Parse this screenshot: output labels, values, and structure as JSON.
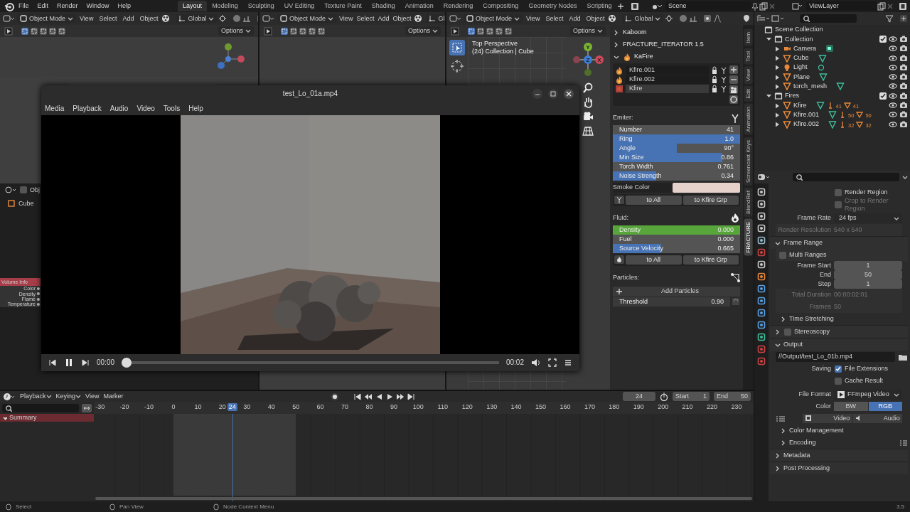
{
  "top_bar": {
    "menus": [
      "File",
      "Edit",
      "Render",
      "Window",
      "Help"
    ],
    "workspaces": [
      {
        "label": "Layout",
        "selected": true
      },
      {
        "label": "Modeling",
        "selected": false
      },
      {
        "label": "Sculpting",
        "selected": false
      },
      {
        "label": "UV Editing",
        "selected": false
      },
      {
        "label": "Texture Paint",
        "selected": false
      },
      {
        "label": "Shading",
        "selected": false
      },
      {
        "label": "Animation",
        "selected": false
      },
      {
        "label": "Rendering",
        "selected": false
      },
      {
        "label": "Compositing",
        "selected": false
      },
      {
        "label": "Geometry Nodes",
        "selected": false
      },
      {
        "label": "Scripting",
        "selected": false
      }
    ],
    "scene": "Scene",
    "view_layer": "ViewLayer"
  },
  "viewports": [
    {
      "mode": "Object Mode",
      "menus": [
        "View",
        "Select",
        "Add",
        "Object"
      ],
      "orientation": "Global",
      "options": "Options"
    },
    {
      "mode": "Object Mode",
      "menus": [
        "View",
        "Select",
        "Add",
        "Object"
      ],
      "orientation": "Gl",
      "options": "Options"
    },
    {
      "mode": "Object Mode",
      "menus": [
        "View",
        "Select",
        "Add",
        "Object"
      ],
      "orientation": "Global",
      "options": "Options",
      "view_name": "Top Perspective",
      "view_info": "(24) Collection | Cube",
      "axes": [
        "X",
        "Y",
        "Z"
      ]
    }
  ],
  "node_editor": {
    "header": "Obj",
    "object": "Cube",
    "node": {
      "title": "Volume Info",
      "sockets": [
        "Color",
        "Density",
        "Flame",
        "Temperature"
      ]
    }
  },
  "sidebar": {
    "sections": [
      {
        "title": "Kaboom",
        "expanded": false
      },
      {
        "title": "FRACTURE_ITERATOR 1.5",
        "expanded": false
      },
      {
        "title": "KaFire",
        "expanded": true
      }
    ],
    "fires": [
      {
        "name": "Kfire.001",
        "selected": false
      },
      {
        "name": "Kfire.002",
        "selected": false
      },
      {
        "name": "Kfire",
        "selected": true
      }
    ],
    "emitter_label": "Emiter:",
    "emitter": [
      {
        "label": "Number",
        "value": "41",
        "kind": "number"
      },
      {
        "label": "Ring",
        "value": "1.0",
        "kind": "slider",
        "level": 1
      },
      {
        "label": "Angle",
        "value": "90°",
        "kind": "slider",
        "level": 0.5
      },
      {
        "label": "Min Size",
        "value": "0.86",
        "kind": "slider",
        "level": 0.86
      },
      {
        "label": "Torch Width",
        "value": "0.761",
        "kind": "number"
      },
      {
        "label": "Noise Strength",
        "value": "0.34",
        "kind": "slider",
        "level": 0.34
      }
    ],
    "smoke_color": {
      "label": "Smoke Color",
      "color": "#e6d2ca"
    },
    "emitter_buttons": [
      "to All",
      "to Kfire Grp"
    ],
    "fluid_label": "Fluid:",
    "fluid": [
      {
        "label": "Density",
        "value": "0.000",
        "kind": "keyed"
      },
      {
        "label": "Fuel",
        "value": "0.000",
        "kind": "number"
      },
      {
        "label": "Source Velocity",
        "value": "0.665",
        "kind": "slider",
        "level": 0.38
      }
    ],
    "fluid_buttons": [
      "to All",
      "to Kfire Grp"
    ],
    "particles_label": "Particles:",
    "add_particles": "Add Particles",
    "threshold": {
      "label": "Threshold",
      "value": "0.90"
    },
    "tabs": [
      {
        "label": "Item",
        "selected": false
      },
      {
        "label": "Tool",
        "selected": false
      },
      {
        "label": "View",
        "selected": false
      },
      {
        "label": "Edit",
        "selected": false
      },
      {
        "label": "Animation",
        "selected": false
      },
      {
        "label": "Screencast Keys",
        "selected": false
      },
      {
        "label": "BlendRef",
        "selected": false
      },
      {
        "label": "FRACTURE",
        "selected": true
      }
    ]
  },
  "video_player": {
    "title": "test_Lo_01a.mp4",
    "menus": [
      "Media",
      "Playback",
      "Audio",
      "Video",
      "Tools",
      "Help"
    ],
    "playing": true,
    "elapsed": "00:00",
    "duration": "00:02",
    "level": 0
  },
  "outliner": {
    "title": "Scene Collection",
    "tree": [
      {
        "name": "Collection",
        "kind": "collection",
        "expanded": true,
        "checked": true,
        "children": [
          {
            "name": "Camera",
            "kind": "camera",
            "expanded": false
          },
          {
            "name": "Cube",
            "kind": "mesh",
            "expanded": false
          },
          {
            "name": "Light",
            "kind": "light",
            "expanded": false
          },
          {
            "name": "Plane",
            "kind": "mesh",
            "expanded": false
          },
          {
            "name": "torch_mesh",
            "kind": "mesh",
            "expanded": false
          }
        ]
      },
      {
        "name": "Fires",
        "kind": "collection",
        "expanded": true,
        "checked": true,
        "children": [
          {
            "name": "Kfire",
            "kind": "mesh",
            "expanded": false,
            "modifiers": [
              "41",
              "41"
            ]
          },
          {
            "name": "Kfire.001",
            "kind": "mesh",
            "expanded": false,
            "modifiers": [
              "50",
              "50"
            ]
          },
          {
            "name": "Kfire.002",
            "kind": "mesh",
            "expanded": false,
            "modifiers": [
              "32",
              "32"
            ]
          }
        ]
      }
    ]
  },
  "properties": {
    "rows": [
      {
        "kind": "check",
        "label": "Render Region",
        "checked": false
      },
      {
        "kind": "check",
        "label": "Crop to Render Region",
        "checked": false,
        "disabled": true
      },
      {
        "kind": "dropdown",
        "label": "Frame Rate",
        "value": "24 fps"
      },
      {
        "kind": "info",
        "label": "Render Resolution",
        "value": "540 x 540"
      },
      {
        "kind": "panel",
        "label": "Frame Range",
        "expanded": true
      },
      {
        "kind": "boxcheck",
        "label": "Multi Ranges",
        "checked": false
      },
      {
        "kind": "field",
        "label": "Frame Start",
        "value": "1"
      },
      {
        "kind": "field",
        "label": "End",
        "value": "50"
      },
      {
        "kind": "field",
        "label": "Step",
        "value": "1"
      },
      {
        "kind": "info",
        "label": "Total Duration",
        "value": "00:00:02:01"
      },
      {
        "kind": "info",
        "label": "Frames",
        "value": "50"
      },
      {
        "kind": "subpanel",
        "label": "Time Stretching",
        "expanded": false
      },
      {
        "kind": "panel",
        "label": "Stereoscopy",
        "expanded": false,
        "checked": false
      },
      {
        "kind": "panel",
        "label": "Output",
        "expanded": true
      },
      {
        "kind": "path",
        "value": "//Output/test_Lo_01b.mp4"
      },
      {
        "kind": "check",
        "prefix": "Saving",
        "label": "File Extensions",
        "checked": true
      },
      {
        "kind": "check",
        "label": "Cache Result",
        "checked": false
      },
      {
        "kind": "dropdown",
        "label": "File Format",
        "value": "FFmpeg Video"
      },
      {
        "kind": "toggle",
        "label": "Color",
        "options": [
          {
            "label": "BW",
            "selected": false
          },
          {
            "label": "RGB",
            "selected": true
          }
        ]
      },
      {
        "kind": "tabs",
        "options": [
          {
            "label": "Video"
          },
          {
            "label": "Audio"
          }
        ]
      },
      {
        "kind": "subpanel",
        "label": "Color Management",
        "expanded": false
      },
      {
        "kind": "subpanel",
        "label": "Encoding",
        "expanded": false
      },
      {
        "kind": "panel",
        "label": "Metadata",
        "expanded": false
      },
      {
        "kind": "panel",
        "label": "Post Processing",
        "expanded": false
      }
    ]
  },
  "timeline": {
    "menus": [
      "Playback",
      "Keying",
      "View",
      "Marker"
    ],
    "current_frame": "24",
    "playhead": "24",
    "start_label": "Start",
    "start": "1",
    "end_label": "End",
    "end": "50",
    "ruler": [
      "-30",
      "-20",
      "-10",
      "0",
      "10",
      "20",
      "30",
      "40",
      "50",
      "60",
      "70",
      "80",
      "90",
      "100",
      "110",
      "120",
      "130",
      "140",
      "150",
      "160",
      "170",
      "180",
      "190",
      "200",
      "210",
      "220",
      "230"
    ],
    "channels": [
      "Summary"
    ]
  },
  "status_bar": {
    "hints": [
      "Select",
      "Pan View",
      "Node Context Menu"
    ],
    "version": "3.5"
  }
}
